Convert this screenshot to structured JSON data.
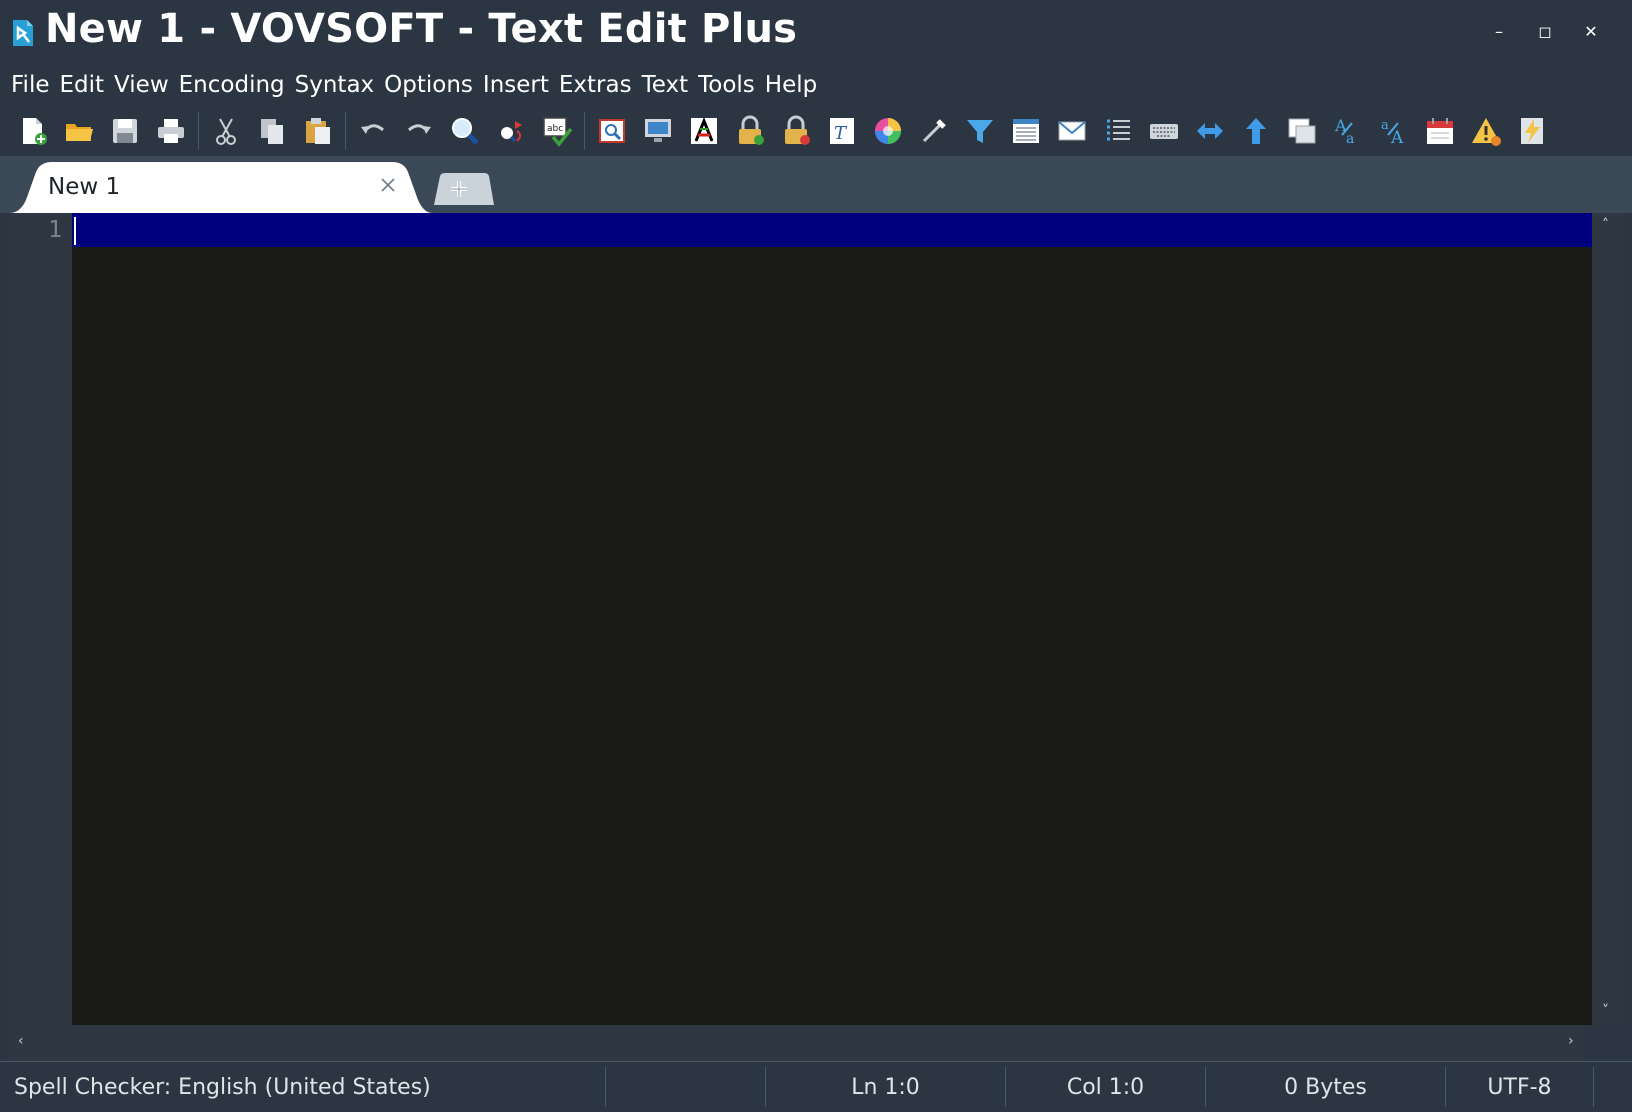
{
  "window": {
    "title": "New 1 - VOVSOFT - Text Edit Plus",
    "app_icon": "app-logo-icon",
    "controls": [
      "minimize-icon",
      "maximize-icon",
      "close-icon"
    ]
  },
  "menu": {
    "items": [
      "File",
      "Edit",
      "View",
      "Encoding",
      "Syntax",
      "Options",
      "Insert",
      "Extras",
      "Text",
      "Tools",
      "Help"
    ]
  },
  "toolbar": {
    "icons": [
      "new-file-icon",
      "open-folder-icon",
      "save-icon",
      "print-icon",
      "cut-icon",
      "copy-icon",
      "paste-icon",
      "undo-icon",
      "redo-icon",
      "find-icon",
      "replace-icon",
      "spell-check-icon",
      "preview-icon",
      "monitor-icon",
      "character-map-icon",
      "encrypt-lock-icon",
      "decrypt-lock-icon",
      "font-icon",
      "color-picker-icon",
      "eyedropper-icon",
      "filter-icon",
      "list-view-icon",
      "email-icon",
      "numbered-list-icon",
      "keyboard-icon",
      "swap-arrows-icon",
      "upload-arrow-icon",
      "window-icon",
      "text-case-upper-icon",
      "text-case-lower-icon",
      "calendar-icon",
      "warning-icon",
      "lightning-icon"
    ]
  },
  "tabs": [
    {
      "label": "New 1",
      "active": true
    }
  ],
  "editor": {
    "line_numbers": [
      "1"
    ],
    "content": "",
    "current_line_color": "#00007f",
    "background_color": "#191a15"
  },
  "status": {
    "spell_checker": "Spell Checker: English (United States)",
    "line": "Ln 1:0",
    "column": "Col 1:0",
    "size": "0 Bytes",
    "encoding": "UTF-8"
  },
  "colors": {
    "chrome": "#2b3642",
    "tabbar": "#3b4856",
    "accent_blue": "#2a8fd6"
  }
}
